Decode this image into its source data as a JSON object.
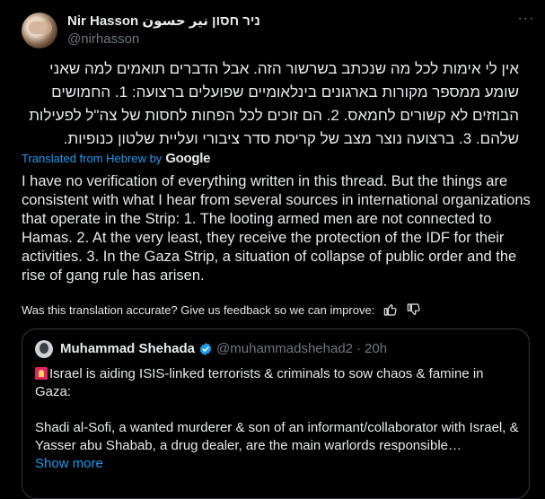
{
  "author": {
    "display_name": "Nir Hasson ניר חסון نير حسون",
    "handle": "@nirhasson"
  },
  "more_icon": "ellipsis-icon",
  "hebrew_text": "אין לי אימות לכל מה שנכתב בשרשור הזה. אבל הדברים תואמים למה שאני שומע ממספר מקורות בארגונים בינלאומיים שפועלים ברצועה: 1. החמושים הבוזזים לא קשורים לחמאס. 2. הם זוכים לכל הפחות לחסות של צה\"ל לפעילות שלהם. 3. ברצועה נוצר מצב של קריסת סדר ציבורי ועליית שלטון כנופיות.",
  "translated_label": "Translated from Hebrew by",
  "google_label": "Google",
  "english_text": "I have no verification of everything written in this thread. But the things are consistent with what I hear from several sources in international organizations that operate in the Strip: 1. The looting armed men are not connected to Hamas. 2. At the very least, they receive the protection of the IDF for their activities. 3. In the Gaza Strip, a situation of collapse of public order and the rise of gang rule has arisen.",
  "feedback_text": "Was this translation accurate? Give us feedback so we can improve:",
  "quote": {
    "display_name": "Muhammad Shehada",
    "handle": "@muhammadshehad2",
    "separator": "·",
    "time": "20h",
    "line1": "Israel is aiding ISIS-linked terrorists & criminals to sow chaos & famine in Gaza:",
    "line2": "Shadi al-Sofi, a wanted murderer & son of an informant/collaborator with Israel, & Yasser abu Shabab, a drug dealer, are the main warlords responsible…",
    "show_more": "Show more"
  },
  "colors": {
    "background": "#000000",
    "text": "#e7e9ea",
    "muted": "#71767b",
    "link": "#1d9bf0",
    "verified": "#1d9bf0"
  }
}
